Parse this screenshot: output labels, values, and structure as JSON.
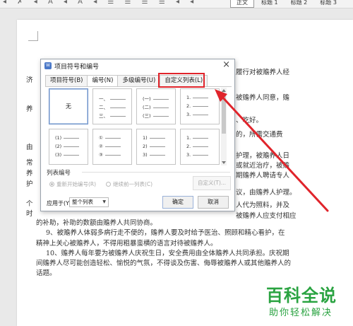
{
  "toolbar": {
    "styles": [
      "正文",
      "标题 1",
      "标题 2",
      "标题 3"
    ]
  },
  "document": {
    "lines": [
      "履行对被赡养人经",
      "济",
      "被赡养人同意，赡",
      "养",
      "、吃好。",
      "的，所需交通费",
      "由",
      "护理，被赡养人日",
      "常",
      "或就近治疗，被赡",
      "养",
      "期赡养人聘请专人",
      "护",
      "议，由赡养人护理。",
      "个",
      "人代为照料，并及",
      "时",
      "被赡养人应支付相应",
      "的补助，补助的数额由赡养人共同协商。",
      "9、被赡养人体弱多病行走不便的，赡养人要及时给予医治、照顾和精心看护，在",
      "精神上关心被赡养人，不得用粗暴蛮横的语言对待被赡养人。",
      "10、赡养人每年要为被赡养人庆祝生日，安全费用由全体赡养人共同承担。庆祝期",
      "间赡养人尽可能创造轻松、愉悦的气氛，不得谈及伤害、侮辱被赡养人或其他赡养人的",
      "话题。"
    ]
  },
  "dialog": {
    "title": "项目符号和编号",
    "tabs": [
      "项目符号(B)",
      "编号(N)",
      "多级编号(U)",
      "自定义列表(L)"
    ],
    "active_tab": "编号(N)",
    "highlighted_tab": "自定义列表(L)",
    "none_label": "无",
    "cells": [
      {
        "markers": [
          "一、",
          "二、",
          "三、"
        ]
      },
      {
        "markers": [
          "(一)",
          "(二)",
          "(三)"
        ]
      },
      {
        "markers": [
          "1.",
          "2.",
          "3."
        ]
      },
      {
        "markers": [
          "(1)",
          "(2)",
          "(3)"
        ]
      },
      {
        "markers": [
          "①",
          "②",
          "③"
        ]
      },
      {
        "markers": [
          "1)",
          "2)",
          "3)"
        ]
      },
      {
        "markers": [
          "1.",
          "2.",
          "3."
        ]
      }
    ],
    "list_number_label": "列表编号",
    "restart_label": "重新开始编号(R)",
    "continue_label": "继续前一列表(C)",
    "custom_button": "自定义(T)...",
    "apply_label": "应用于(Y):",
    "apply_value": "整个列表",
    "ok": "确定",
    "cancel": "取消"
  },
  "watermark": {
    "title": "百科全说",
    "subtitle": "助你轻松解决"
  },
  "colors": {
    "highlight": "#e0242b",
    "watermark": "#2aa341"
  }
}
